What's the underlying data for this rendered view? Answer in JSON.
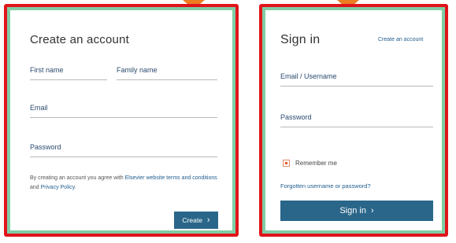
{
  "colors": {
    "frame": "#e0141b",
    "accent": "#ee7d22",
    "button": "#2a6689",
    "edge": "#7fcda4"
  },
  "create_account": {
    "title": "Create an account",
    "first_name_label": "First name",
    "family_name_label": "Family name",
    "email_label": "Email",
    "password_label": "Password",
    "terms_prefix": "By creating an account you agree with ",
    "terms_link": "Elsevier website terms and conditions",
    "terms_middle": " and ",
    "privacy_link": "Privacy Policy",
    "terms_suffix": ".",
    "create_button": "Create",
    "button_icon": "chevron-right-icon"
  },
  "sign_in": {
    "title": "Sign in",
    "create_account_link": "Create an account",
    "email_label": "Email / Username",
    "password_label": "Password",
    "remember_label": "Remember me",
    "remember_checked": true,
    "forgot_link": "Forgotten username or password?",
    "sign_in_button": "Sign in",
    "button_icon": "chevron-right-icon"
  }
}
